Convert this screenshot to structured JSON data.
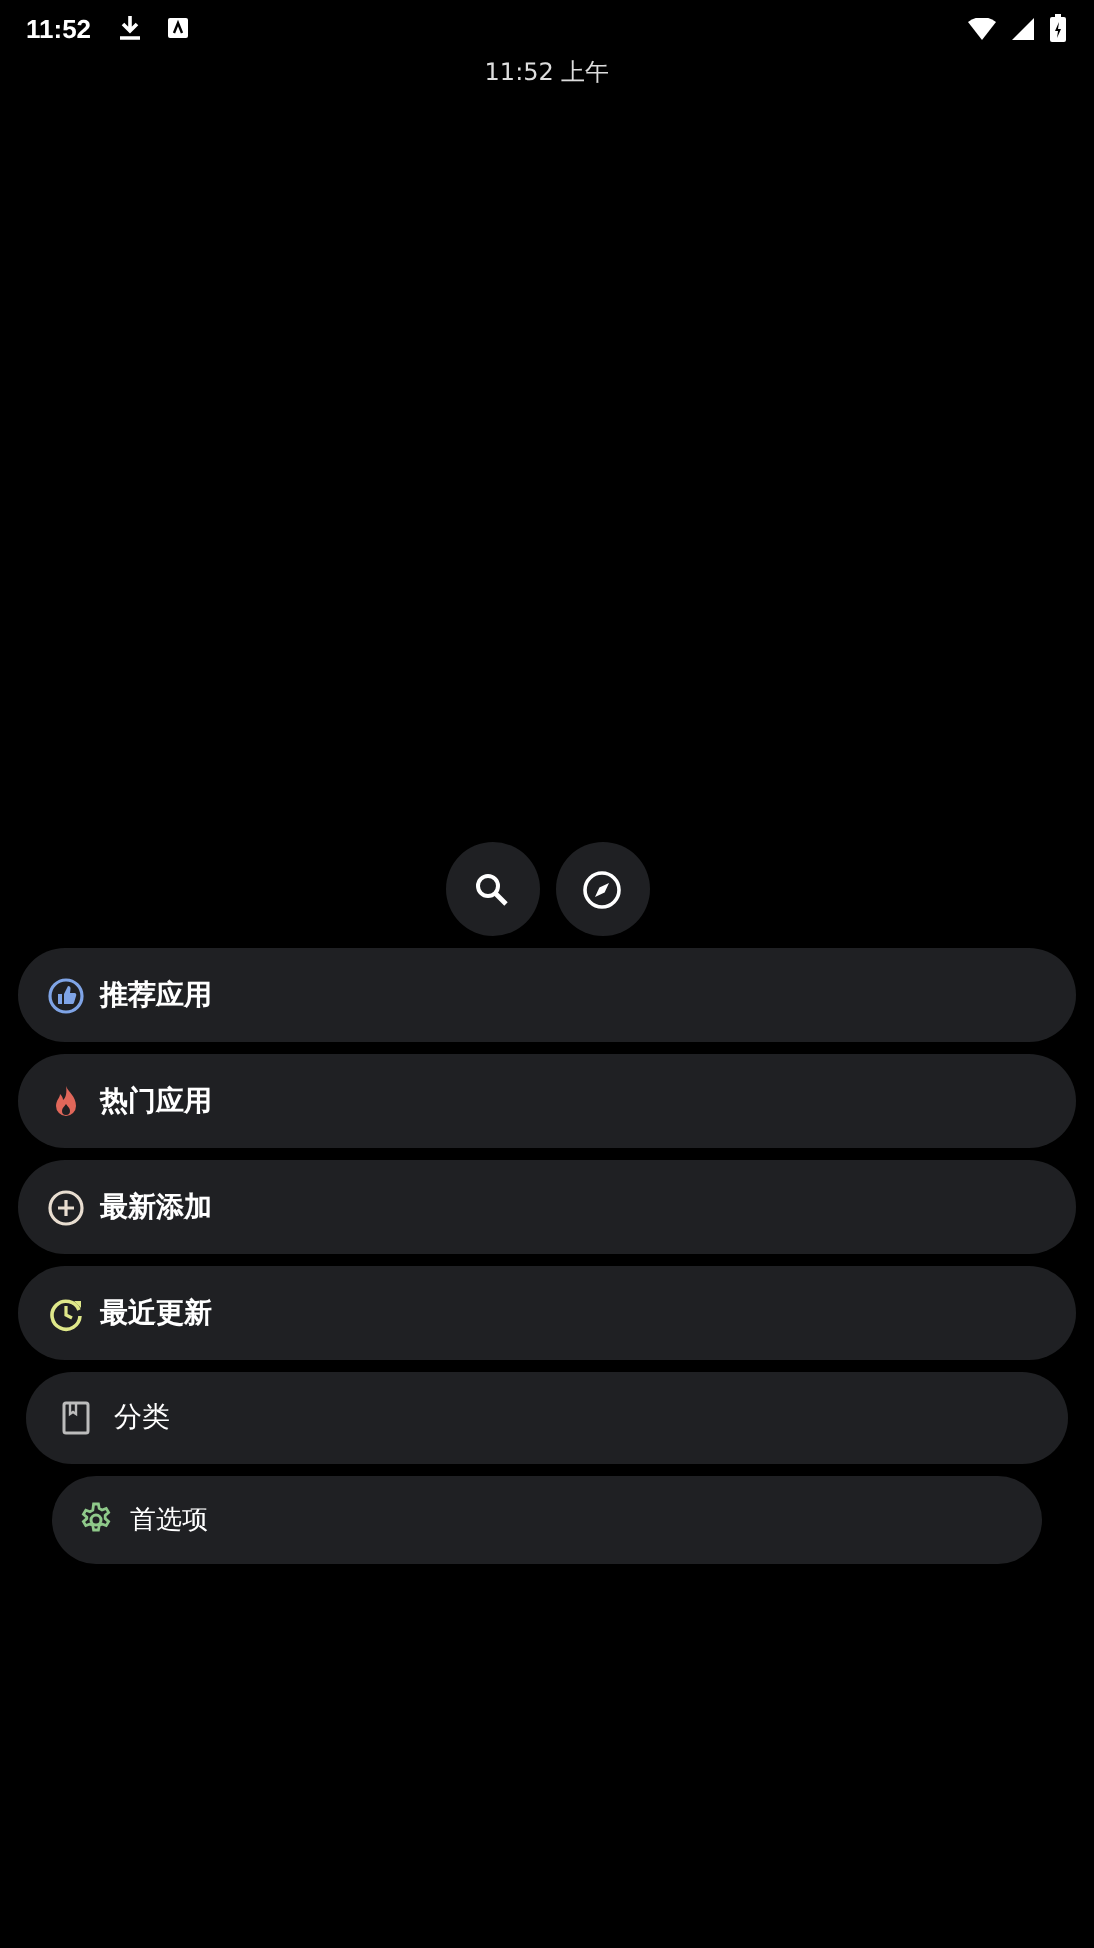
{
  "status_bar": {
    "time": "11:52"
  },
  "clock": {
    "text": "11:52 上午"
  },
  "action_buttons": [
    {
      "kind": "search"
    },
    {
      "kind": "compass"
    }
  ],
  "menu": [
    {
      "label": "推荐应用",
      "kind": "thumb",
      "color": "#7fa4e6"
    },
    {
      "label": "热门应用",
      "kind": "fire",
      "color": "#e0675a"
    },
    {
      "label": "最新添加",
      "kind": "plus",
      "color": "#e8ddd0"
    },
    {
      "label": "最近更新",
      "kind": "clock",
      "color": "#dfe88a"
    },
    {
      "label": "分类",
      "kind": "book",
      "color": "#bcbcbc"
    },
    {
      "label": "首选项",
      "kind": "gear",
      "color": "#8fc98a"
    }
  ]
}
